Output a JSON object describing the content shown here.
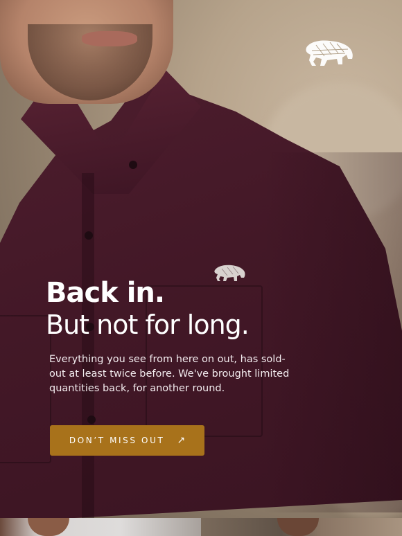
{
  "hero": {
    "headline_line1": "Back in.",
    "headline_line2": "But not for long.",
    "body": "Everything you see from here on out, has sold-out at least twice before. We've brought limited quantities back, for another round.",
    "cta_label": "DON’T MISS OUT",
    "cta_icon": "arrow-up-right-icon",
    "logo_icon": "elephant-logo-icon",
    "pocket_logo_icon": "elephant-embroidery-icon"
  },
  "colors": {
    "shirt": "#431827",
    "cta_background": "#a8721b",
    "text": "#ffffff"
  }
}
